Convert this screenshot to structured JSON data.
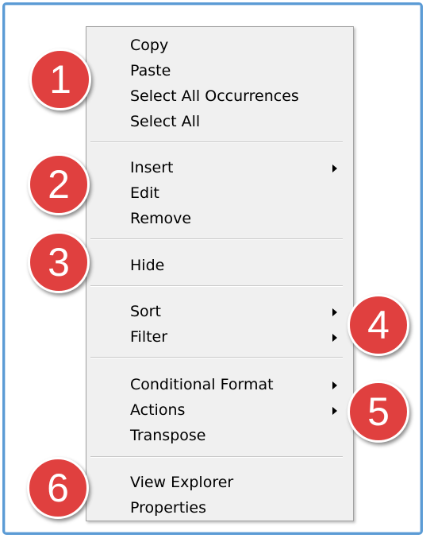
{
  "menu": {
    "items": [
      {
        "label": "Copy",
        "submenu": false
      },
      {
        "label": "Paste",
        "submenu": false
      },
      {
        "label": "Select All Occurrences",
        "submenu": false
      },
      {
        "label": "Select All",
        "submenu": false
      },
      {
        "label": "Insert",
        "submenu": true
      },
      {
        "label": "Edit",
        "submenu": false
      },
      {
        "label": "Remove",
        "submenu": false
      },
      {
        "label": "Hide",
        "submenu": false
      },
      {
        "label": "Sort",
        "submenu": true
      },
      {
        "label": "Filter",
        "submenu": true
      },
      {
        "label": "Conditional Format",
        "submenu": true
      },
      {
        "label": "Actions",
        "submenu": true
      },
      {
        "label": "Transpose",
        "submenu": false
      },
      {
        "label": "View Explorer",
        "submenu": false
      },
      {
        "label": "Properties",
        "submenu": false
      }
    ]
  },
  "callouts": [
    "1",
    "2",
    "3",
    "4",
    "5",
    "6"
  ],
  "colors": {
    "frame_border": "#5b9bd5",
    "menu_bg": "#f0f0f0",
    "callout_fill": "#e0403f"
  },
  "icons": {
    "submenu_indicator": "chevron-right-icon"
  }
}
